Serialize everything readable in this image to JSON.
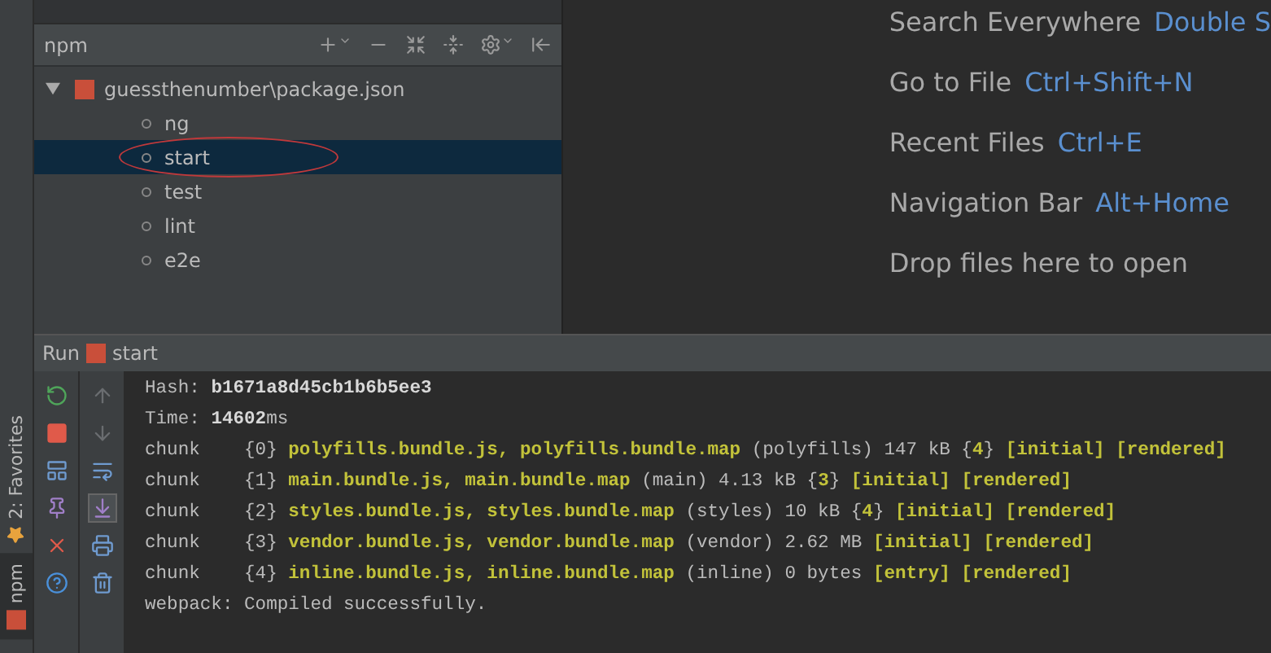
{
  "side_tabs": [
    {
      "label": "2: Favorites",
      "selected": false,
      "kind": "favorites"
    },
    {
      "label": "npm",
      "selected": true,
      "kind": "npm"
    }
  ],
  "npm_panel": {
    "title": "npm",
    "tree": {
      "label": "guessthenumber\\package.json",
      "expanded": true,
      "children": [
        {
          "label": "ng",
          "selected": false
        },
        {
          "label": "start",
          "selected": true
        },
        {
          "label": "test",
          "selected": false
        },
        {
          "label": "lint",
          "selected": false
        },
        {
          "label": "e2e",
          "selected": false
        }
      ]
    }
  },
  "editor_hints": [
    {
      "action": "Search Everywhere",
      "shortcut": "Double S"
    },
    {
      "action": "Go to File",
      "shortcut": "Ctrl+Shift+N"
    },
    {
      "action": "Recent Files",
      "shortcut": "Ctrl+E"
    },
    {
      "action": "Navigation Bar",
      "shortcut": "Alt+Home"
    }
  ],
  "drop_hint": "Drop files here to open",
  "run_panel": {
    "title": "Run",
    "config": "start",
    "scroll_to_end": true,
    "console": [
      [
        {
          "t": "Hash: ",
          "kind": "plain"
        },
        {
          "t": "b1671a8d45cb1b6b5ee3",
          "kind": "strong"
        }
      ],
      [
        {
          "t": "Time: ",
          "kind": "plain"
        },
        {
          "t": "14602",
          "kind": "strong"
        },
        {
          "t": "ms",
          "kind": "plain"
        }
      ],
      [
        {
          "t": "chunk    {0} ",
          "kind": "plain"
        },
        {
          "t": "polyfills.bundle.js, polyfills.bundle.map",
          "kind": "file"
        },
        {
          "t": " (polyfills) 147 kB {",
          "kind": "plain"
        },
        {
          "t": "4",
          "kind": "file"
        },
        {
          "t": "} ",
          "kind": "plain"
        },
        {
          "t": "[initial] [rendered]",
          "kind": "file"
        }
      ],
      [
        {
          "t": "chunk    {1} ",
          "kind": "plain"
        },
        {
          "t": "main.bundle.js, main.bundle.map",
          "kind": "file"
        },
        {
          "t": " (main) 4.13 kB {",
          "kind": "plain"
        },
        {
          "t": "3",
          "kind": "file"
        },
        {
          "t": "} ",
          "kind": "plain"
        },
        {
          "t": "[initial] [rendered]",
          "kind": "file"
        }
      ],
      [
        {
          "t": "chunk    {2} ",
          "kind": "plain"
        },
        {
          "t": "styles.bundle.js, styles.bundle.map",
          "kind": "file"
        },
        {
          "t": " (styles) 10 kB {",
          "kind": "plain"
        },
        {
          "t": "4",
          "kind": "file"
        },
        {
          "t": "} ",
          "kind": "plain"
        },
        {
          "t": "[initial] [rendered]",
          "kind": "file"
        }
      ],
      [
        {
          "t": "chunk    {3} ",
          "kind": "plain"
        },
        {
          "t": "vendor.bundle.js, vendor.bundle.map",
          "kind": "file"
        },
        {
          "t": " (vendor) 2.62 MB ",
          "kind": "plain"
        },
        {
          "t": "[initial] [rendered]",
          "kind": "file"
        }
      ],
      [
        {
          "t": "chunk    {4} ",
          "kind": "plain"
        },
        {
          "t": "inline.bundle.js, inline.bundle.map",
          "kind": "file"
        },
        {
          "t": " (inline) 0 bytes ",
          "kind": "plain"
        },
        {
          "t": "[entry] [rendered]",
          "kind": "file"
        }
      ],
      [
        {
          "t": "webpack: Compiled successfully.",
          "kind": "plain"
        }
      ]
    ]
  }
}
